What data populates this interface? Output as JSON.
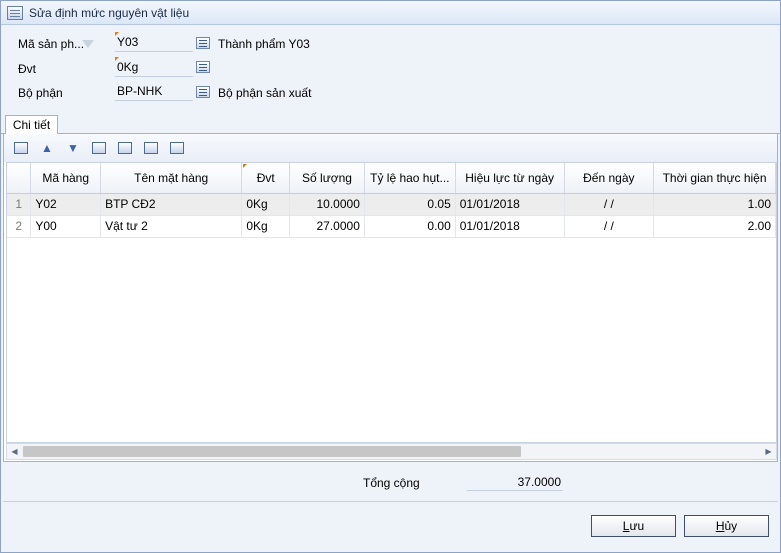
{
  "window": {
    "title": "Sửa định mức nguyên vật liệu"
  },
  "form": {
    "product_code_label": "Mã sản ph...",
    "product_code_value": "Y03",
    "product_name": "Thành phẩm Y03",
    "unit_label": "Đvt",
    "unit_value": "0Kg",
    "department_label": "Bộ phận",
    "department_value": "BP-NHK",
    "department_name": "Bộ phận sản xuất"
  },
  "tabs": [
    {
      "label": "Chi tiết"
    }
  ],
  "toolbar": {
    "icons": [
      "new-row-icon",
      "move-up-icon",
      "move-down-icon",
      "copy-icon",
      "delete-row-icon",
      "import-icon",
      "columns-icon"
    ]
  },
  "grid": {
    "columns": [
      "Mã hàng",
      "Tên mặt hàng",
      "Đvt",
      "Số lượng",
      "Tỷ lệ hao hụt...",
      "Hiệu lực từ ngày",
      "Đến ngày",
      "Thời gian thực hiện"
    ],
    "rows": [
      {
        "num": "1",
        "code": "Y02",
        "name": "BTP CĐ2",
        "unit": "0Kg",
        "qty": "10.0000",
        "loss": "0.05",
        "from": "01/01/2018",
        "to": "/ /",
        "time": "1.00"
      },
      {
        "num": "2",
        "code": "Y00",
        "name": "Vật tư 2",
        "unit": "0Kg",
        "qty": "27.0000",
        "loss": "0.00",
        "from": "01/01/2018",
        "to": "/ /",
        "time": "2.00"
      }
    ]
  },
  "summary": {
    "total_label": "Tổng cộng",
    "total_value": "37.0000"
  },
  "buttons": {
    "save_label": "Lưu",
    "save_underline": "L",
    "save_rest": "ưu",
    "cancel_first": "H",
    "cancel_rest": "ủy"
  }
}
